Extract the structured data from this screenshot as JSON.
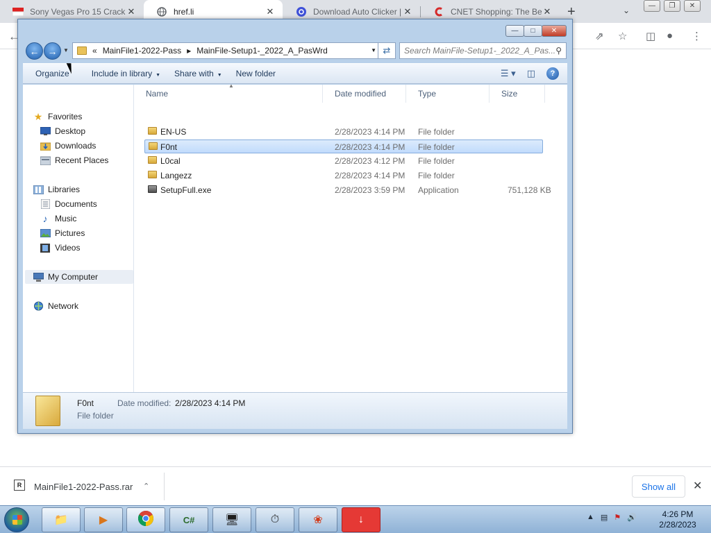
{
  "browser": {
    "tabs": [
      {
        "label": "Sony Vegas Pro 15 Crack",
        "icon": "flag-icon",
        "active": false
      },
      {
        "label": "href.li",
        "icon": "globe-icon",
        "active": true
      },
      {
        "label": "Download Auto Clicker | Ju",
        "icon": "at-sign-icon",
        "active": false
      },
      {
        "label": "CNET Shopping: The Best",
        "icon": "cnet-icon",
        "active": false
      }
    ],
    "tab_close_glyph": "✕",
    "new_tab_glyph": "+"
  },
  "explorer": {
    "breadcrumb": {
      "prefix": "«",
      "parts": [
        "MainFile1-2022-Pass",
        "MainFile-Setup1-_2022_A_PasWrd"
      ]
    },
    "search_placeholder": "Search MainFile-Setup1-_2022_A_Pas...",
    "commands": {
      "organize": "Organize",
      "include": "Include in library",
      "share": "Share with",
      "new_folder": "New folder"
    },
    "nav": {
      "favorites": "Favorites",
      "desktop": "Desktop",
      "downloads": "Downloads",
      "recent": "Recent Places",
      "libraries": "Libraries",
      "documents": "Documents",
      "music": "Music",
      "pictures": "Pictures",
      "videos": "Videos",
      "computer": "My Computer",
      "network": "Network"
    },
    "columns": {
      "name": "Name",
      "date": "Date modified",
      "type": "Type",
      "size": "Size"
    },
    "files": [
      {
        "name": "EN-US",
        "date": "2/28/2023 4:14 PM",
        "type": "File folder",
        "size": "",
        "kind": "folder",
        "selected": false
      },
      {
        "name": "F0nt",
        "date": "2/28/2023 4:14 PM",
        "type": "File folder",
        "size": "",
        "kind": "folder",
        "selected": true
      },
      {
        "name": "L0cal",
        "date": "2/28/2023 4:12 PM",
        "type": "File folder",
        "size": "",
        "kind": "folder",
        "selected": false
      },
      {
        "name": "Langezz",
        "date": "2/28/2023 4:14 PM",
        "type": "File folder",
        "size": "",
        "kind": "folder",
        "selected": false
      },
      {
        "name": "SetupFull.exe",
        "date": "2/28/2023 3:59 PM",
        "type": "Application",
        "size": "751,128 KB",
        "kind": "app",
        "selected": false
      }
    ],
    "details": {
      "name": "F0nt",
      "modified_label": "Date modified:",
      "modified_value": "2/28/2023 4:14 PM",
      "type": "File folder"
    }
  },
  "downloads": {
    "file": "MainFile1-2022-Pass.rar",
    "show_all": "Show all"
  },
  "taskbar": {
    "apps": [
      "folder-icon",
      "media-player-icon",
      "chrome-icon",
      "csharp-icon",
      "monitor-icon",
      "speedometer-icon",
      "firefox-like-icon",
      "download-arrow-icon"
    ],
    "time": "4:26 PM",
    "date": "2/28/2023"
  }
}
